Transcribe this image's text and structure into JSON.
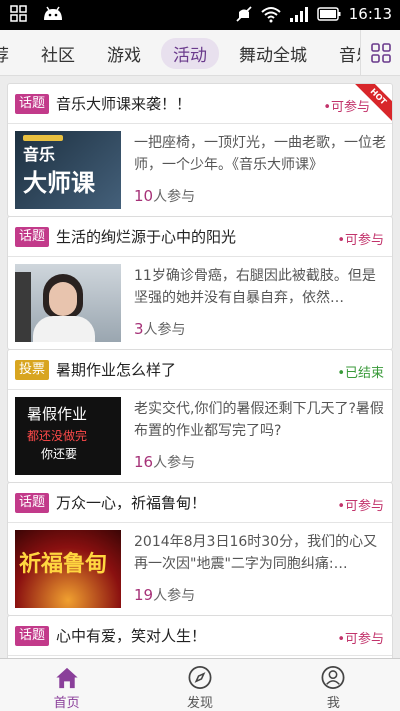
{
  "status_bar": {
    "time": "16:13",
    "icons": [
      "apps-grid-icon",
      "android-icon",
      "mute-icon",
      "wifi-icon",
      "signal-icon",
      "battery-icon"
    ]
  },
  "tabs": {
    "items": [
      {
        "label": "荐"
      },
      {
        "label": "社区"
      },
      {
        "label": "游戏"
      },
      {
        "label": "活动"
      },
      {
        "label": "舞动全城"
      },
      {
        "label": "音乐"
      }
    ],
    "active_index": 3,
    "grid_icon": "grid-menu-icon"
  },
  "feed": {
    "cards": [
      {
        "badge": "话题",
        "title": "音乐大师课来袭！！",
        "status": "•可参与",
        "hot": "HOT",
        "desc": "一把座椅，一顶灯光，一曲老歌，一位老师，一个少年。《音乐大师课》",
        "count": "10",
        "count_suffix": "人参与",
        "thumb_text_1": "音乐",
        "thumb_text_2": "大师课"
      },
      {
        "badge": "话题",
        "title": "生活的绚烂源于心中的阳光",
        "status": "•可参与",
        "desc": "11岁确诊骨癌，右腿因此被截肢。但是坚强的她并没有自暴自弃，依然…",
        "count": "3",
        "count_suffix": "人参与"
      },
      {
        "badge": "投票",
        "title": "暑期作业怎么样了",
        "status": "•已结束",
        "desc": "老实交代,你们的暑假还剩下几天了?暑假布置的作业都写完了吗?",
        "count": "16",
        "count_suffix": "人参与",
        "thumb_text_1": "暑假作业",
        "thumb_text_2": "都还没做完",
        "thumb_text_3": "你还要"
      },
      {
        "badge": "话题",
        "title": "万众一心，祈福鲁甸！",
        "status": "•可参与",
        "desc": "2014年8月3日16时30分，我们的心又再一次因\"地震\"二字为同胞纠痛:…",
        "count": "19",
        "count_suffix": "人参与",
        "thumb_text_1": "祈福鲁甸"
      },
      {
        "badge": "话题",
        "title": "心中有爱，笑对人生！",
        "status": "•可参与"
      }
    ]
  },
  "bottom_nav": {
    "items": [
      {
        "label": "首页",
        "icon": "home-icon"
      },
      {
        "label": "发现",
        "icon": "compass-icon"
      },
      {
        "label": "我",
        "icon": "user-icon"
      }
    ],
    "active_index": 0
  },
  "colors": {
    "accent": "#8a3f9a",
    "badge_topic": "#c23a8a",
    "badge_vote": "#d8a520",
    "status_open": "#c2336b",
    "status_ended": "#3a9a3a"
  }
}
